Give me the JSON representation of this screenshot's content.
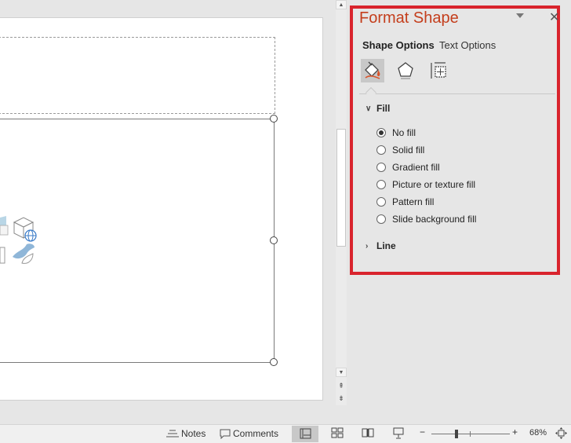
{
  "pane": {
    "title": "Format Shape",
    "tabs": [
      "Shape Options",
      "Text Options"
    ],
    "category_icons": [
      "fill-line-icon",
      "effects-icon",
      "size-properties-icon"
    ],
    "sections": {
      "fill": {
        "label": "Fill",
        "expanded": true,
        "options": [
          {
            "label": "No fill",
            "selected": true
          },
          {
            "label": "Solid fill",
            "selected": false
          },
          {
            "label": "Gradient fill",
            "selected": false
          },
          {
            "label": "Picture or texture fill",
            "selected": false
          },
          {
            "label": "Pattern fill",
            "selected": false
          },
          {
            "label": "Slide background fill",
            "selected": false
          }
        ]
      },
      "line": {
        "label": "Line",
        "expanded": false
      }
    },
    "highlight_color": "#d9242d",
    "title_color": "#c43e1c"
  },
  "statusbar": {
    "notes": "Notes",
    "comments": "Comments",
    "zoom": "68%",
    "zoom_minus": "−",
    "zoom_plus": "+"
  }
}
